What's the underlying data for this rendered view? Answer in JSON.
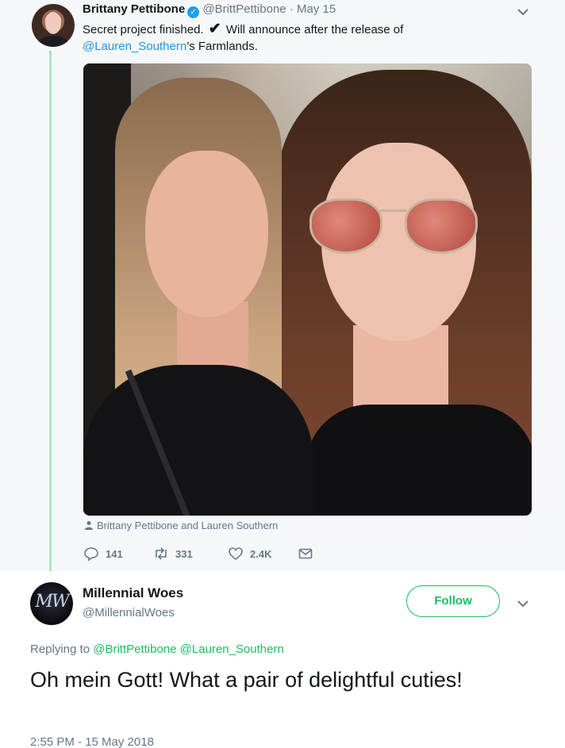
{
  "original_tweet": {
    "name": "Brittany Pettibone",
    "handle": "@BrittPettibone",
    "separator": "·",
    "date": "May 15",
    "text_before_check": "Secret project finished.",
    "check_glyph": "✔",
    "text_after_check": "Will announce after the release of",
    "mention": "@Lauren_Southern",
    "text_end": "’s Farmlands.",
    "photo_caption": "Brittany Pettibone and Lauren Southern",
    "counts": {
      "replies": "141",
      "retweets": "331",
      "likes": "2.4K"
    },
    "icons": {
      "avatar": "avatar",
      "verified": "verified-badge-icon",
      "caret": "chevron-down-icon",
      "reply": "reply-icon",
      "retweet": "retweet-icon",
      "like": "heart-icon",
      "message": "envelope-icon",
      "person": "person-icon"
    }
  },
  "reply_tweet": {
    "name": "Millennial Woes",
    "handle": "@MillennialWoes",
    "avatar_text": "MW",
    "follow_label": "Follow",
    "replying_to_label": "Replying to",
    "replying_to_users": [
      "@BrittPettibone",
      "@Lauren_Southern"
    ],
    "text": "Oh mein Gott! What a pair of delightful cuties!",
    "timestamp": "2:55 PM - 15 May 2018"
  },
  "colors": {
    "twitter_blue": "#1b95e0",
    "accent_green": "#17bf63",
    "thread_line": "#a8e2c0",
    "muted_text": "#657786",
    "quoted_bg": "#f5f8fa"
  }
}
